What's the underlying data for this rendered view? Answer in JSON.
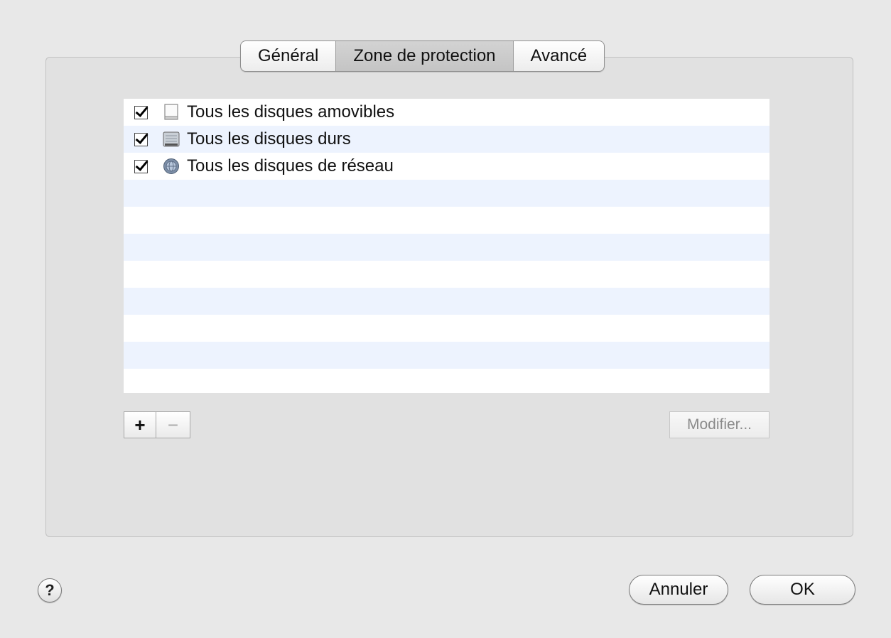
{
  "tabs": [
    {
      "label": "Général",
      "active": false
    },
    {
      "label": "Zone de protection",
      "active": true
    },
    {
      "label": "Avancé",
      "active": false
    }
  ],
  "items": [
    {
      "label": "Tous les disques amovibles",
      "checked": true,
      "icon": "removable-disk-icon"
    },
    {
      "label": "Tous les disques durs",
      "checked": true,
      "icon": "hard-disk-icon"
    },
    {
      "label": "Tous les disques de réseau",
      "checked": true,
      "icon": "network-disk-icon"
    }
  ],
  "list_controls": {
    "add_label": "+",
    "remove_label": "−",
    "modify_label": "Modifier..."
  },
  "footer": {
    "help_label": "?",
    "cancel_label": "Annuler",
    "ok_label": "OK"
  },
  "colors": {
    "row_alt": "#edf3fe",
    "background": "#e8e8e8"
  }
}
